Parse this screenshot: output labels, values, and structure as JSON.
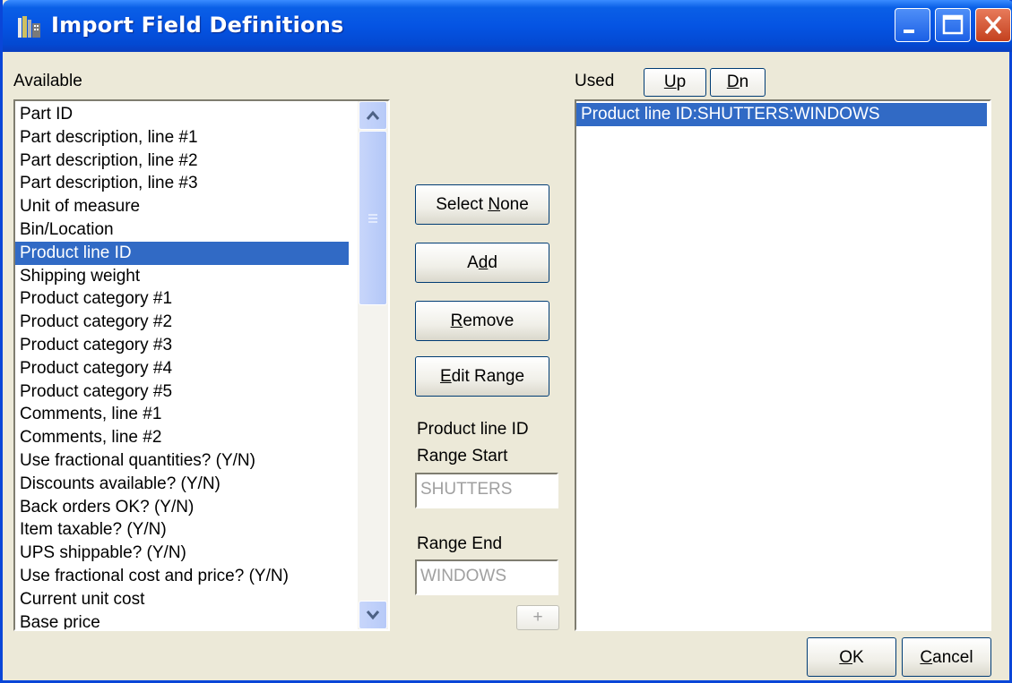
{
  "window": {
    "title": "Import Field Definitions"
  },
  "available": {
    "label": "Available",
    "items": [
      "Part ID",
      "Part description, line #1",
      "Part description, line #2",
      "Part description, line #3",
      "Unit of measure",
      "Bin/Location",
      "Product line ID",
      "Shipping weight",
      "Product category #1",
      "Product category #2",
      "Product category #3",
      "Product category #4",
      "Product category #5",
      "Comments, line #1",
      "Comments, line #2",
      "Use fractional quantities? (Y/N)",
      "Discounts available? (Y/N)",
      "Back orders OK? (Y/N)",
      "Item taxable? (Y/N)",
      "UPS shippable? (Y/N)",
      "Use fractional cost and price? (Y/N)",
      "Current unit cost",
      "Base price"
    ],
    "selected_index": 6
  },
  "buttons": {
    "select_none": {
      "pre": "Select ",
      "key": "N",
      "post": "one"
    },
    "add": {
      "pre": "A",
      "key": "d",
      "post": "d"
    },
    "remove": {
      "pre": "",
      "key": "R",
      "post": "emove"
    },
    "edit_range": {
      "pre": "",
      "key": "E",
      "post": "dit Range"
    },
    "plus": "+",
    "ok": {
      "pre": "",
      "key": "O",
      "post": "K"
    },
    "cancel": {
      "pre": "",
      "key": "C",
      "post": "ancel"
    }
  },
  "range": {
    "field_name": "Product line ID",
    "start_label": "Range Start",
    "start_value": "SHUTTERS",
    "end_label": "Range End",
    "end_value": "WINDOWS"
  },
  "used": {
    "label": "Used",
    "up": {
      "key": "U",
      "post": "p"
    },
    "dn": {
      "key": "D",
      "post": "n"
    },
    "items": [
      "Product line ID:SHUTTERS:WINDOWS"
    ]
  },
  "colors": {
    "titlebar": "#0554e3",
    "selection": "#316ac5",
    "face": "#ece9d8"
  }
}
